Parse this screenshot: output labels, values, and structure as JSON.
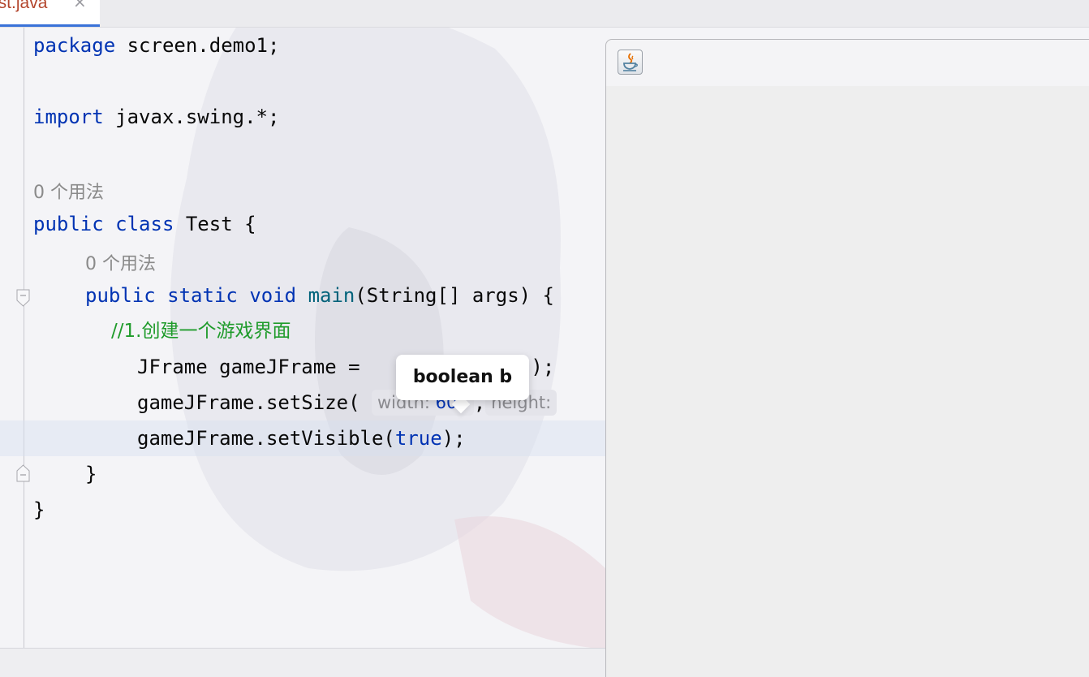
{
  "tab": {
    "label": "est.java",
    "close_glyph": "×"
  },
  "code": {
    "line1": {
      "kw": "package",
      "rest": " screen.demo1;"
    },
    "line2": {
      "kw": "import",
      "rest": " javax.swing.*;"
    },
    "usage_hint_class": "0 个用法",
    "line3": {
      "kw1": "public",
      "kw2": "class",
      "rest": " Test {"
    },
    "usage_hint_main": "0 个用法",
    "line4": {
      "kw1": "public",
      "kw2": "static",
      "kw3": "void",
      "fn": "main",
      "rest": "(String[] args) {"
    },
    "comment": "//1.创建一个游戏界面",
    "line5_a": "JFrame gameJFrame = ",
    "line5_b": "();",
    "line6_a": "gameJFrame.setSize(",
    "inlay_width_label": "width:",
    "inlay_width_value": "608",
    "line6_b": ",",
    "inlay_height_label": "height:",
    "line7_a": "gameJFrame.setVisible(",
    "line7_kw": "true",
    "line7_b": ");",
    "close_inner": "}",
    "close_outer": "}"
  },
  "tooltip": {
    "text": "boolean b"
  },
  "swing_window": {
    "icon": "java-coffee-icon"
  },
  "colors": {
    "keyword": "#0033b3",
    "function": "#00627a",
    "comment": "#1f9b2b",
    "tab_text": "#b3452c",
    "accent": "#3a72d8"
  }
}
